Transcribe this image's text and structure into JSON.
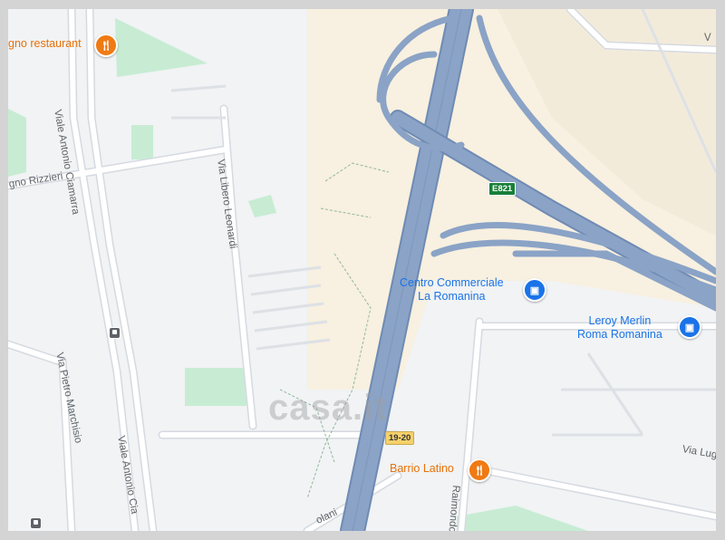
{
  "colors": {
    "land": "#f1f3f4",
    "sand": "#f8f0e0",
    "park": "#c7ecd3",
    "highway": "#8aa3c6",
    "highway_edge": "#6f8bb4",
    "road": "#ffffff",
    "road_edge": "#d5dae1",
    "orange": "#e8710a",
    "blue": "#1a73e8"
  },
  "streets": {
    "antonio_ciamarra_top": "Viale Antonio Ciamarra",
    "antonio_ciamarra_bottom": "Viale Antonio Cia",
    "libero_leonardi": "Via Libero Leonardi",
    "pietro_marchisio": "Via Pietro Marchisio",
    "rizzieri": "gno Rizzieri",
    "raimondo": "Raimondo",
    "via_lug": "Via Lug",
    "olani": "olani",
    "v_top_right": "V"
  },
  "pois": {
    "restaurant_top": {
      "name": "gno restaurant",
      "icon": "fork-knife-icon"
    },
    "barrio_latino": {
      "name": "Barrio Latino",
      "icon": "fork-knife-icon"
    },
    "centro_commerciale": {
      "line1": "Centro Commerciale",
      "line2": "La Romanina",
      "icon": "shopping-bag-icon"
    },
    "leroy_merlin": {
      "line1": "Leroy Merlin",
      "line2": "Roma Romanina",
      "icon": "shopping-bag-icon"
    }
  },
  "shields": {
    "e821": "E821",
    "exit_19_20": "19-20"
  },
  "watermark": "casa.it"
}
